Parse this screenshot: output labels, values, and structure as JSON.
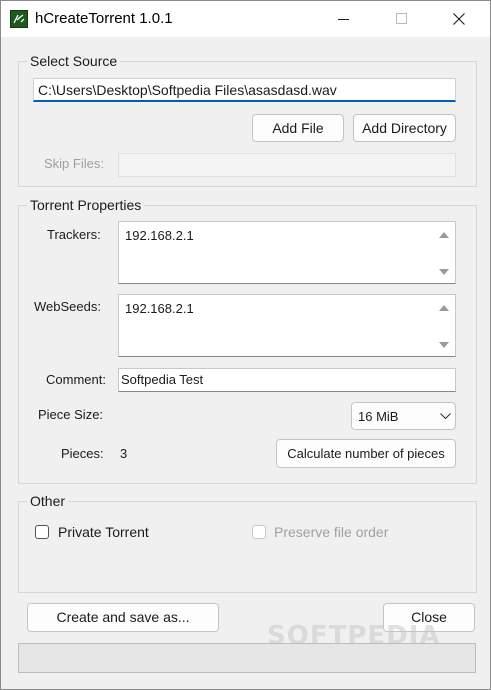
{
  "window": {
    "title": "hCreateTorrent 1.0.1",
    "icon": "hct-app-icon",
    "controls": {
      "minimize": "minimize-icon",
      "maximize": "maximize-icon",
      "close": "close-icon"
    }
  },
  "source": {
    "group_label": "Select Source",
    "path_value": "C:\\Users\\Desktop\\Softpedia Files\\asasdasd.wav",
    "add_file_label": "Add File",
    "add_directory_label": "Add Directory",
    "skip_files_label": "Skip Files:",
    "skip_files_value": ""
  },
  "properties": {
    "group_label": "Torrent Properties",
    "trackers_label": "Trackers:",
    "trackers_value": "192.168.2.1",
    "webseeds_label": "WebSeeds:",
    "webseeds_value": "192.168.2.1",
    "comment_label": "Comment:",
    "comment_value": "Softpedia Test",
    "piece_size_label": "Piece Size:",
    "piece_size_value": "16 MiB",
    "pieces_label": "Pieces:",
    "pieces_value": "3",
    "calculate_label": "Calculate number of pieces"
  },
  "other": {
    "group_label": "Other",
    "private_torrent_label": "Private Torrent",
    "private_torrent_checked": false,
    "preserve_order_label": "Preserve file order",
    "preserve_order_checked": false,
    "preserve_order_enabled": false
  },
  "footer": {
    "create_label": "Create and save as...",
    "close_label": "Close",
    "progress_fraction": 0
  },
  "watermark": "SOFTPEDIA",
  "colors": {
    "accent": "#005fb8",
    "window_bg": "#f0f0f0",
    "titlebar_bg": "#ffffff",
    "progress_fill": "#06b025"
  }
}
